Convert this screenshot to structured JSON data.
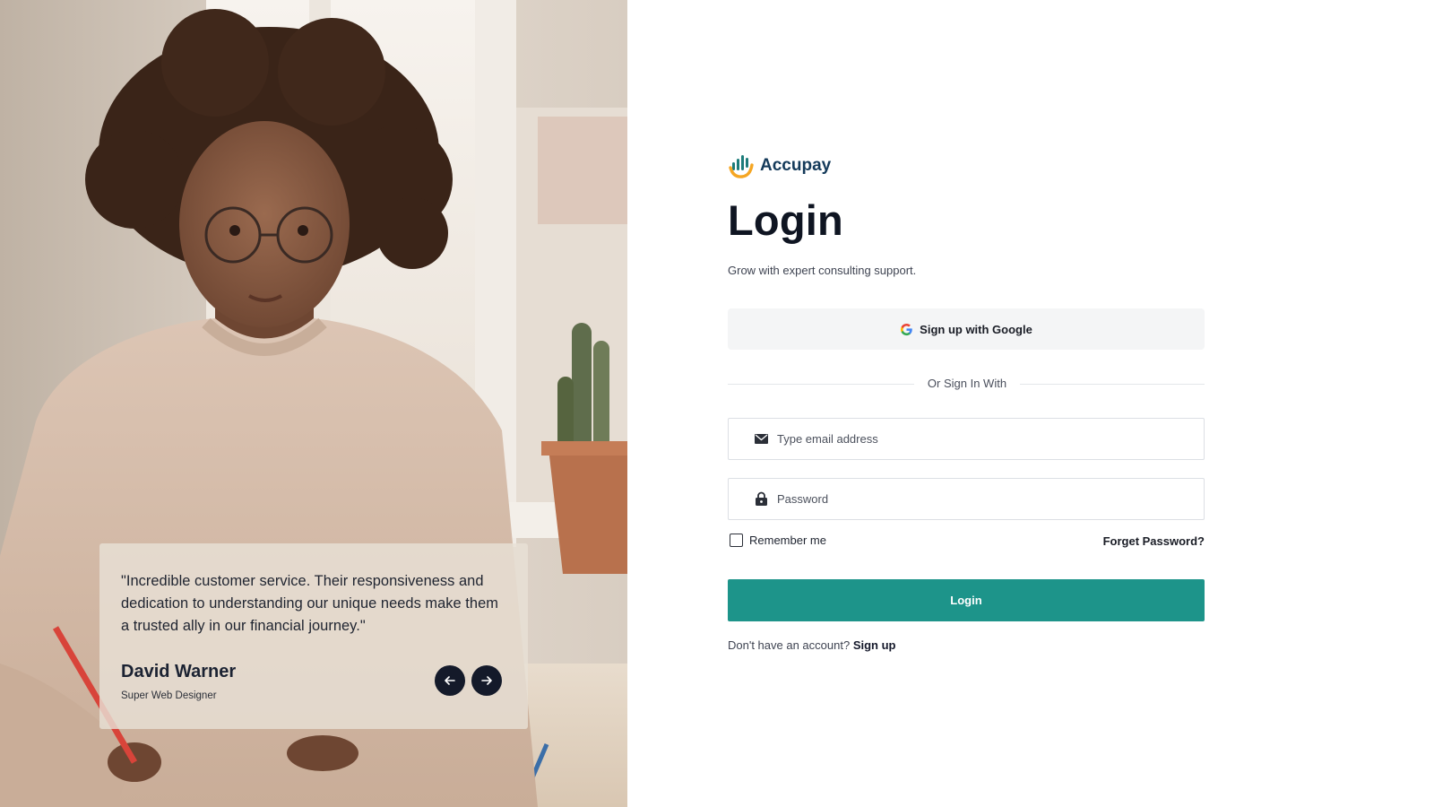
{
  "brand": {
    "name": "Accupay",
    "logo_icon": "accupay-logo-icon"
  },
  "login": {
    "title": "Login",
    "subtitle": "Grow with expert consulting support.",
    "google_button_label": "Sign up with Google",
    "divider_text": "Or Sign In With",
    "email_placeholder": "Type email address",
    "password_placeholder": "Password",
    "remember_label": "Remember me",
    "forgot_label": "Forget Password?",
    "submit_label": "Login",
    "no_account_text": "Don't have an account?",
    "signup_link": "Sign up"
  },
  "testimonial": {
    "quote": "\"Incredible customer service. Their responsiveness and dedication to understanding our unique needs make them a trusted ally in our financial journey.\"",
    "author": "David Warner",
    "role": "Super Web Designer"
  },
  "icons": {
    "email": "envelope-icon",
    "password": "lock-icon",
    "google": "google-g-icon",
    "prev": "arrow-left-icon",
    "next": "arrow-right-icon"
  },
  "colors": {
    "accent": "#1d948a",
    "brand_text": "#143a5a",
    "nav_button": "#141a2a",
    "logo_teal": "#1d7c7a",
    "logo_orange": "#f5a623"
  }
}
